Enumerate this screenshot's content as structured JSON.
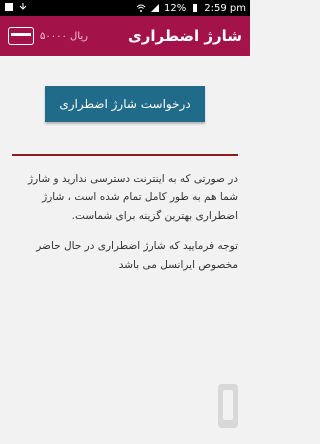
{
  "status_bar": {
    "battery": "12%",
    "time": "2:59 pm"
  },
  "app_bar": {
    "title": "شارژ اضطراری",
    "balance": "۵۰۰۰۰ ریال"
  },
  "main": {
    "request_button": "درخواست شارژ اضطراری",
    "paragraph1": "در صورتی که به اینترنت دسترسی ندارید و شارژ شما هم به طور کامل تمام شده است ، شارژ اضطراری بهترین گزینه برای شماست.",
    "paragraph2": "توجه فرمایید که شارژ اضطراری در حال حاضر مخصوص ایرانسل می باشد"
  }
}
